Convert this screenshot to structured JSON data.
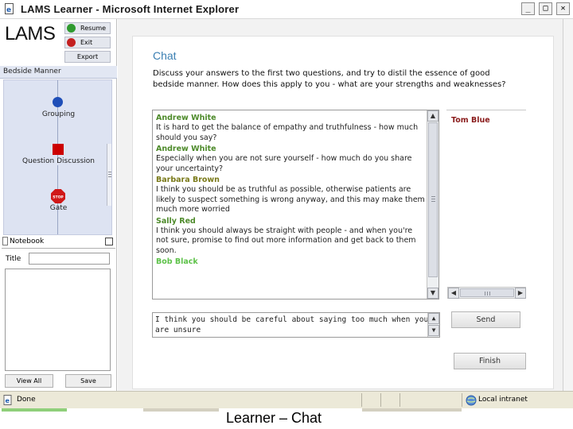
{
  "window": {
    "title": "LAMS Learner - Microsoft Internet Explorer",
    "min_glyph": "_",
    "max_glyph": "□",
    "close_glyph": "✕"
  },
  "sidebar": {
    "logo": "LAMS",
    "controls": {
      "resume": "Resume",
      "exit": "Exit",
      "export": "Export"
    },
    "sequence_title": "Bedside Manner",
    "activities": [
      {
        "label": "Grouping"
      },
      {
        "label": "Question Discussion"
      },
      {
        "label": "Gate"
      }
    ],
    "gate_icon_text": "STOP",
    "notebook": {
      "header": "Notebook",
      "title_label": "Title",
      "title_value": "",
      "view_all": "View All",
      "save": "Save"
    }
  },
  "chat": {
    "heading": "Chat",
    "instructions": "Discuss your answers to the first two questions, and try to distil the essence of good bedside manner. How does this apply to you - what are your strengths and weaknesses?",
    "messages": [
      {
        "name": "Andrew White",
        "color": "#4d8a2a",
        "text": "It is hard to get the balance of empathy and truthfulness - how much should you say?"
      },
      {
        "name": "Andrew White",
        "color": "#4d8a2a",
        "text": "Especially when you are not sure yourself - how much do you share your uncertainty?"
      },
      {
        "name": "Barbara Brown",
        "color": "#7a7a1a",
        "text": "I think you should be as truthful as possible, otherwise patients are likely to suspect something is wrong anyway, and this may make them much more worried"
      },
      {
        "name": "Sally Red",
        "color": "#4d8a2a",
        "text": "I think you should always be straight with people - and when you're not sure, promise to find out more information and get back to them soon."
      },
      {
        "name": "Bob Black",
        "color": "#5ec24a",
        "text": ""
      }
    ],
    "users": [
      "Tom Blue"
    ],
    "user_color": "#8a1c1c",
    "input_value": "I think you should be careful about saying too much when you are unsure",
    "send": "Send",
    "finish": "Finish"
  },
  "statusbar": {
    "text": "Done",
    "zone": "Local intranet"
  },
  "caption": "Learner – Chat",
  "colors": {
    "accent": "#3b7fb2",
    "grouping_node": "#1f4fb8",
    "discussion_node": "#cc0000",
    "gate_node": "#d01818"
  }
}
